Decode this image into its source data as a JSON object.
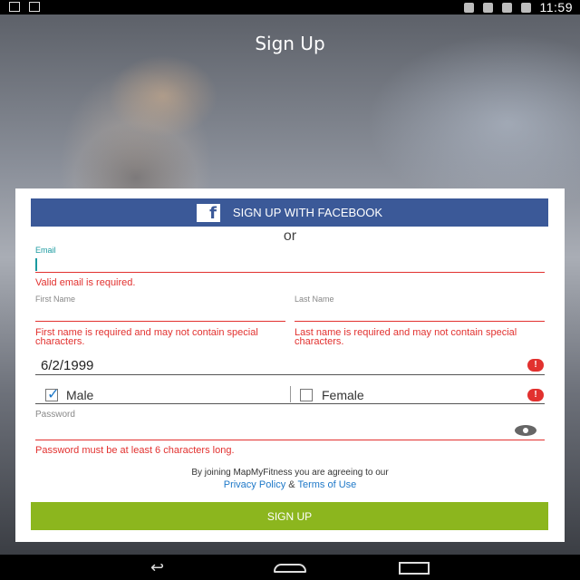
{
  "status_bar": {
    "time": "11:59"
  },
  "page": {
    "title": "Sign Up"
  },
  "facebook": {
    "label": "SIGN UP WITH FACEBOOK",
    "icon_letter": "f"
  },
  "divider_text": "or",
  "email": {
    "label": "Email",
    "value": "",
    "error": "Valid email is required."
  },
  "first_name": {
    "label": "First Name",
    "error": "First name is required and may not contain special characters."
  },
  "last_name": {
    "label": "Last Name",
    "error": "Last name is required and may not contain special characters."
  },
  "birthdate": {
    "value": "6/2/1999"
  },
  "gender": {
    "male": "Male",
    "female": "Female",
    "male_checked": true,
    "female_checked": false
  },
  "password": {
    "label": "Password",
    "error": "Password must be at least 6 characters long."
  },
  "terms": {
    "text": "By joining MapMyFitness you are agreeing to our",
    "privacy": "Privacy Policy",
    "amp": "&",
    "tos": "Terms of Use"
  },
  "signup_button": "SIGN UP",
  "colors": {
    "facebook": "#3b5998",
    "signup": "#8cb61e",
    "error": "#e2312f",
    "accent": "#1a9aa0",
    "link": "#1e78c8"
  }
}
